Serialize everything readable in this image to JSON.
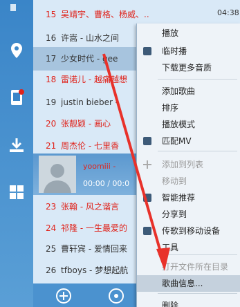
{
  "list": {
    "rows": [
      {
        "num": "15",
        "title": "吴靖宇、曹格、杨威、..",
        "style": "red"
      },
      {
        "num": "16",
        "title": "许嵩 - 山水之间",
        "style": "dark"
      },
      {
        "num": "17",
        "title": "少女时代 - gee",
        "style": "dark hl"
      },
      {
        "num": "18",
        "title": "雷诺儿 - 越痛越想",
        "style": "red"
      },
      {
        "num": "19",
        "title": "justin bieber -",
        "style": "dark"
      },
      {
        "num": "20",
        "title": "张靓颖 - 画心",
        "style": "red"
      },
      {
        "num": "21",
        "title": "周杰伦 - 七里香",
        "style": "red"
      },
      {
        "num": "23",
        "title": "张翰 - 风之谐言",
        "style": "red"
      },
      {
        "num": "24",
        "title": "祁隆 - 一生最爱的",
        "style": "red"
      },
      {
        "num": "25",
        "title": "曹轩宾 - 爱情回来",
        "style": "dark"
      },
      {
        "num": "26",
        "title": "tfboys - 梦想起航",
        "style": "dark"
      }
    ],
    "top_time": "04:38"
  },
  "player": {
    "name": "yoomiii - ",
    "time": "00:00 / 00:0"
  },
  "menu": {
    "items": [
      {
        "label": "播放",
        "state": "normal"
      },
      {
        "label": "临时播",
        "state": "normal"
      },
      {
        "label": "下载更多音质",
        "state": "normal"
      },
      {
        "label": "添加歌曲",
        "state": "normal"
      },
      {
        "label": "排序",
        "state": "normal"
      },
      {
        "label": "播放模式",
        "state": "normal"
      },
      {
        "label": "匹配MV",
        "state": "normal"
      },
      {
        "label": "添加到列表",
        "state": "disabled"
      },
      {
        "label": "移动到",
        "state": "disabled"
      },
      {
        "label": "智能推荐",
        "state": "normal"
      },
      {
        "label": "分享到",
        "state": "normal"
      },
      {
        "label": "传歌到移动设备",
        "state": "normal"
      },
      {
        "label": "工具",
        "state": "normal"
      },
      {
        "label": "打开文件所在目录",
        "state": "disabled"
      },
      {
        "label": "歌曲信息...",
        "state": "selected"
      },
      {
        "label": "删除",
        "state": "normal"
      }
    ]
  },
  "colors": {
    "accent_red": "#e0231b",
    "arrow": "#e8312a",
    "rail": "#3a85c8"
  }
}
